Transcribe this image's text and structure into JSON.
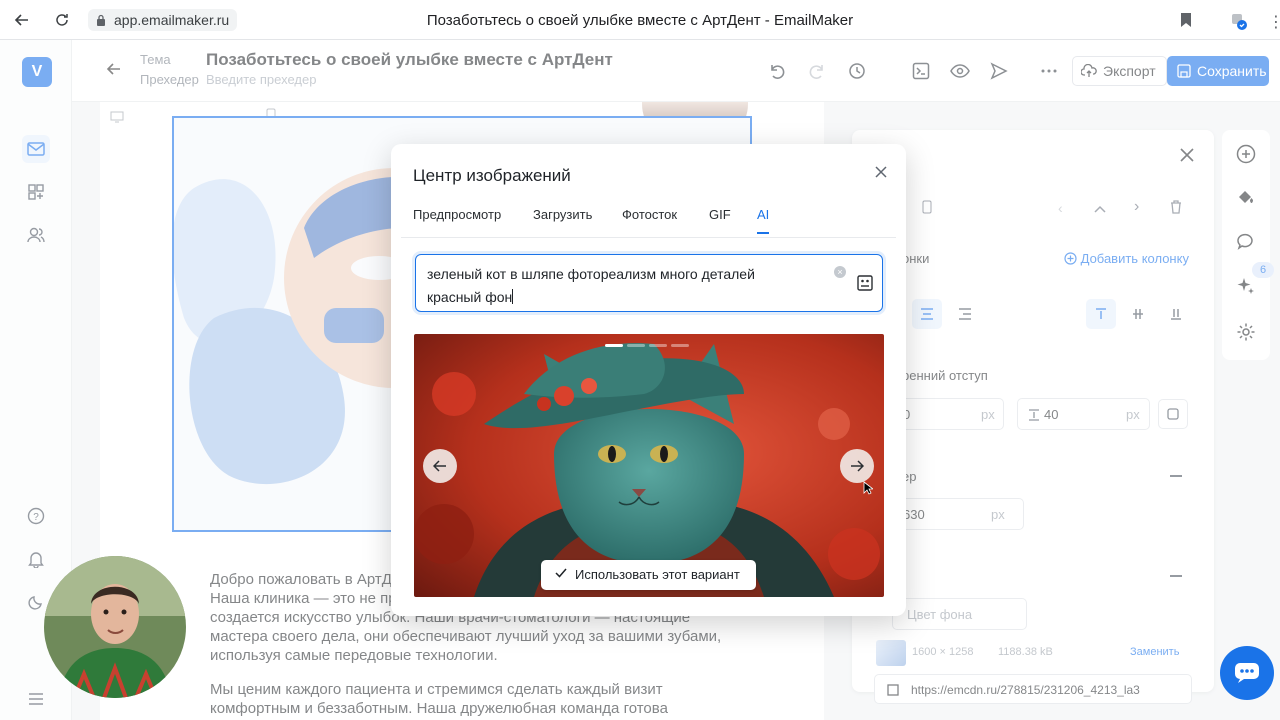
{
  "browser": {
    "url": "app.emailmaker.ru",
    "tab_title": "Позаботьтесь о своей улыбке вместе с АртДент - EmailMaker"
  },
  "rail": {
    "logo_letter": "V"
  },
  "header": {
    "theme_label": "Тема",
    "preheader_label": "Прехедер",
    "subject": "Позаботьтесь о своей улыбке вместе с АртДент",
    "preheader_placeholder": "Введите прехедер",
    "export_label": "Экспорт",
    "save_label": "Сохранить"
  },
  "email": {
    "paragraph1": [
      "Добро пожаловать в АртДент!",
      "Наша клиника — это не просто",
      "создается искусство улыбок. Наши врачи-стоматологи — настоящие",
      "мастера своего дела, они обеспечивают лучший уход за вашими зубами,",
      "используя самые передовые технологии."
    ],
    "paragraph2": [
      "Мы ценим каждого пациента и стремимся сделать каждый визит",
      "комфортным и беззаботным. Наша дружелюбная команда готова"
    ]
  },
  "props": {
    "add_column": "Добавить колонку",
    "columns_label": "онки",
    "inner_padding_label": "ренний отступ",
    "padding_left_value": "0",
    "padding_unit": "px",
    "padding_top_value": "40",
    "size_label": "ер",
    "width_value": "630",
    "bg_color_placeholder": "Цвет фона",
    "image_dims": "1600 × 1258",
    "image_size": "1188.38 kB",
    "replace_label": "Заменить",
    "image_url": "https://emcdn.ru/278815/231206_4213_la3"
  },
  "far_rail": {
    "badge_count": "6"
  },
  "modal": {
    "title": "Центр изображений",
    "tabs": [
      "Предпросмотр",
      "Загрузить",
      "Фотосток",
      "GIF",
      "AI"
    ],
    "active_tab": "AI",
    "prompt_line1": "зеленый кот в шляпе фотореализм много деталей",
    "prompt_line2": "красный фон",
    "use_variant_label": "Использовать этот вариант"
  },
  "colors": {
    "accent": "#1a73e8",
    "image_bg_red": "#c8361f",
    "cat_teal": "#3f8f8a"
  }
}
